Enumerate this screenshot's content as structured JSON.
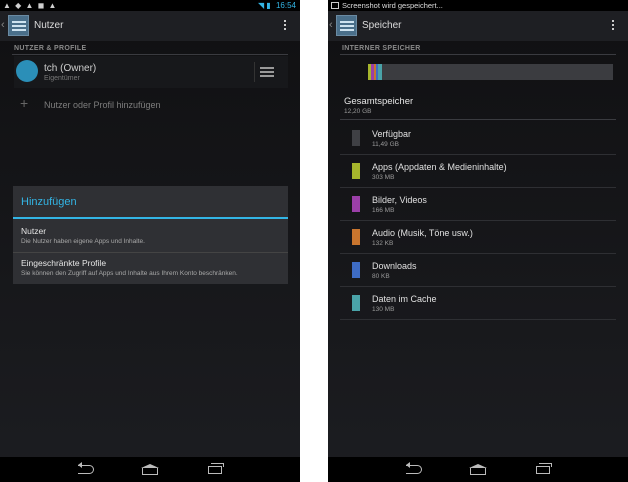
{
  "left": {
    "status": {
      "time": "16:54",
      "notif_icons": "▲ ◆ ▲ ◼ ▲"
    },
    "actionbar": {
      "title": "Nutzer",
      "icon": "settings-app-icon"
    },
    "section": "NUTZER & PROFILE",
    "owner": {
      "name": "tch (Owner)",
      "subtitle": "Eigentümer"
    },
    "add_user": {
      "plus": "+",
      "label": "Nutzer oder Profil hinzufügen"
    },
    "dialog": {
      "title": "Hinzufügen",
      "items": [
        {
          "title": "Nutzer",
          "subtitle": "Die Nutzer haben eigene Apps und Inhalte."
        },
        {
          "title": "Eingeschränkte Profile",
          "subtitle": "Sie können den Zugriff auf Apps und Inhalte aus Ihrem Konto beschränken."
        }
      ]
    }
  },
  "right": {
    "status": {
      "notification": "Screenshot wird gespeichert..."
    },
    "actionbar": {
      "title": "Speicher",
      "icon": "settings-app-icon"
    },
    "section": "INTERNER SPEICHER",
    "total": {
      "label": "Gesamtspeicher",
      "value": "12,20 GB"
    },
    "categories": [
      {
        "label": "Verfügbar",
        "value": "11,49 GB",
        "color": "#3f4044"
      },
      {
        "label": "Apps (Appdaten & Medieninhalte)",
        "value": "303 MB",
        "color": "#a6b52c"
      },
      {
        "label": "Bilder, Videos",
        "value": "166 MB",
        "color": "#9b3fa8"
      },
      {
        "label": "Audio (Musik, Töne usw.)",
        "value": "132 KB",
        "color": "#c8752e"
      },
      {
        "label": "Downloads",
        "value": "80 KB",
        "color": "#3e6cc4"
      },
      {
        "label": "Daten im Cache",
        "value": "130 MB",
        "color": "#4aa3a8"
      }
    ]
  },
  "colors": {
    "accent": "#33b5e5",
    "background": "#16171a"
  }
}
